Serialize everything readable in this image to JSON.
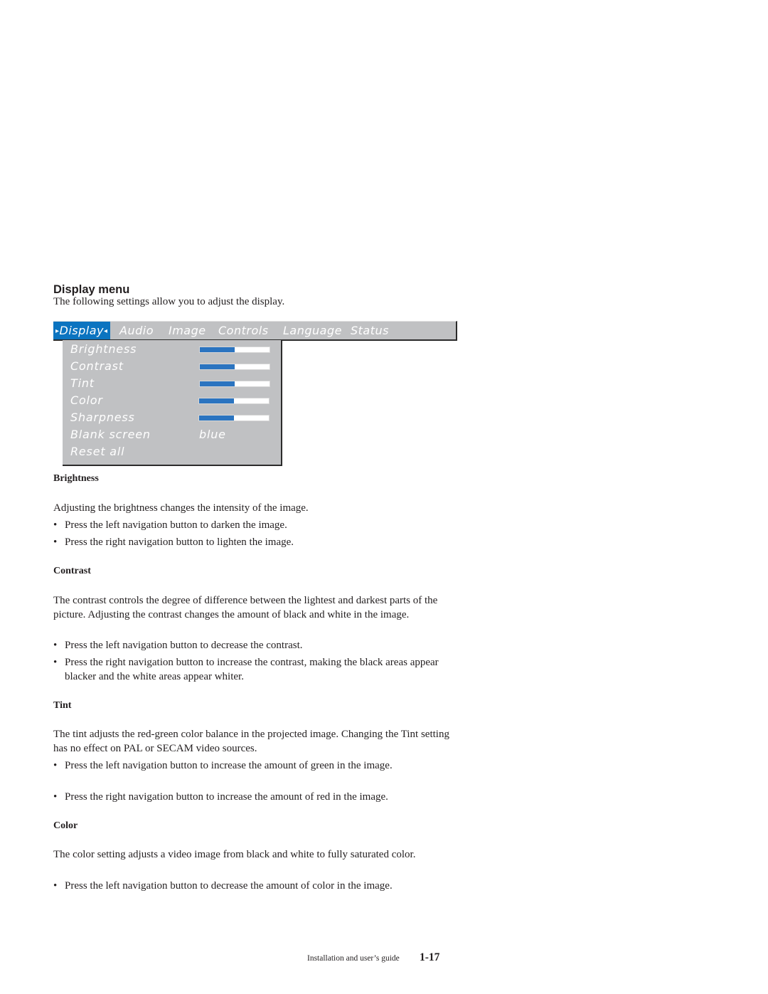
{
  "section": {
    "title": "Display menu",
    "intro": "The following settings allow you to adjust the display."
  },
  "osd_menu": {
    "tabs": [
      {
        "label": "Display",
        "active": true
      },
      {
        "label": "Audio",
        "active": false
      },
      {
        "label": "Image",
        "active": false
      },
      {
        "label": "Controls",
        "active": false
      },
      {
        "label": "Language",
        "active": false
      },
      {
        "label": "Status",
        "active": false
      }
    ],
    "active_marker_left": "▸",
    "active_marker_right": "◂",
    "items": [
      {
        "label": "Brightness",
        "type": "slider",
        "value_percent": 50
      },
      {
        "label": "Contrast",
        "type": "slider",
        "value_percent": 50
      },
      {
        "label": "Tint",
        "type": "slider",
        "value_percent": 50
      },
      {
        "label": "Color",
        "type": "slider",
        "value_percent": 50
      },
      {
        "label": "Sharpness",
        "type": "slider",
        "value_percent": 50
      },
      {
        "label": "Blank screen",
        "type": "value",
        "value": "blue"
      },
      {
        "label": "Reset all",
        "type": "action"
      }
    ],
    "colors": {
      "background": "#c0c1c3",
      "active_tab": "#0b74c0",
      "slider_fill": "#2b74c0",
      "text": "#ffffff"
    }
  },
  "subsections": [
    {
      "heading": "Brightness",
      "paragraphs": [
        "Adjusting the brightness changes the intensity of the image."
      ],
      "bullets": [
        "Press the left navigation button to darken the image.",
        "Press the right navigation button to lighten the image."
      ]
    },
    {
      "heading": "Contrast",
      "paragraphs": [
        "The contrast controls the degree of difference between the lightest and darkest parts of the picture. Adjusting the contrast changes the amount of black and white in the image."
      ],
      "bullets": [
        "Press the left navigation button to decrease the contrast.",
        "Press the right navigation button to increase the contrast, making the black areas appear blacker and the white areas appear whiter."
      ]
    },
    {
      "heading": "Tint",
      "paragraphs": [
        "The tint adjusts the red-green color balance in the projected image. Changing the Tint setting has no effect on PAL or SECAM video sources."
      ],
      "bullets": [
        "Press the left navigation button to increase the amount of green in the image.",
        "Press the right navigation button to increase the amount of red in the image."
      ]
    },
    {
      "heading": "Color",
      "paragraphs": [
        "The color setting adjusts a video image from black and white to fully saturated color."
      ],
      "bullets": [
        "Press the left navigation button to decrease the amount of color in the image."
      ]
    }
  ],
  "bullet_glyph": "•",
  "footer": {
    "text": "Installation and user’s guide",
    "page": "1-17"
  }
}
